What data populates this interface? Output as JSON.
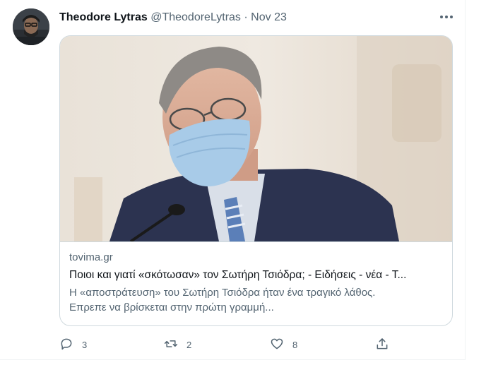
{
  "tweet": {
    "author_name": "Theodore Lytras",
    "author_handle": "@TheodoreLytras",
    "separator": "·",
    "date": "Nov 23",
    "card": {
      "domain": "tovima.gr",
      "title": "Ποιοι και γιατί «σκότωσαν» τον Σωτήρη Τσιόδρα; - Ειδήσεις - νέα - Τ...",
      "description_line1": "Η «αποστράτευση» του Σωτήρη Τσιόδρα ήταν ένα τραγικό λάθος.",
      "description_line2": "Επρεπε να βρίσκεται στην πρώτη γραμμή..."
    },
    "actions": {
      "reply_count": "3",
      "retweet_count": "2",
      "like_count": "8"
    }
  },
  "colors": {
    "text_primary": "#0f1419",
    "text_secondary": "#536471",
    "border": "#cfd9de"
  },
  "icons": [
    "more-icon",
    "reply-icon",
    "retweet-icon",
    "like-icon",
    "share-icon"
  ]
}
